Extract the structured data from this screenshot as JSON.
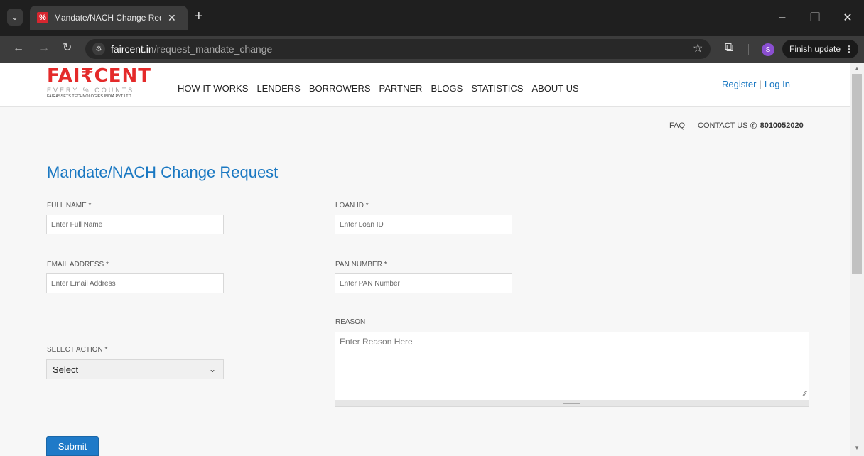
{
  "browser": {
    "favicon": "%",
    "tab_title": "Mandate/NACH Change Reque",
    "url_host": "faircent.in",
    "url_path": "/request_mandate_change",
    "profile_initial": "S",
    "update_label": "Finish update"
  },
  "header": {
    "logo_text": "FAI₹CENT",
    "logo_tagline": "EVERY % COUNTS",
    "logo_company": "FAIRASSETS TECHNOLOGIES INDIA PVT LTD",
    "nav": [
      "HOW IT WORKS",
      "LENDERS",
      "BORROWERS",
      "PARTNER",
      "BLOGS",
      "STATISTICS",
      "ABOUT US"
    ],
    "register": "Register",
    "divider": "|",
    "login": "Log In"
  },
  "subbar": {
    "faq": "FAQ",
    "contact": "CONTACT US",
    "phone": "8010052020"
  },
  "form": {
    "title": "Mandate/NACH Change Request",
    "full_name_label": "FULL NAME *",
    "full_name_placeholder": "Enter Full Name",
    "loan_id_label": "LOAN ID *",
    "loan_id_placeholder": "Enter Loan ID",
    "email_label": "EMAIL ADDRESS *",
    "email_placeholder": "Enter Email Address",
    "pan_label": "PAN NUMBER *",
    "pan_placeholder": "Enter PAN Number",
    "reason_label": "REASON",
    "reason_placeholder": "Enter Reason Here",
    "action_label": "SELECT ACTION *",
    "action_selected": "Select",
    "submit_label": "Submit"
  },
  "colors": {
    "brand_red": "#e42a2a",
    "link_blue": "#1a78c2",
    "button_blue": "#1f7ac8"
  }
}
